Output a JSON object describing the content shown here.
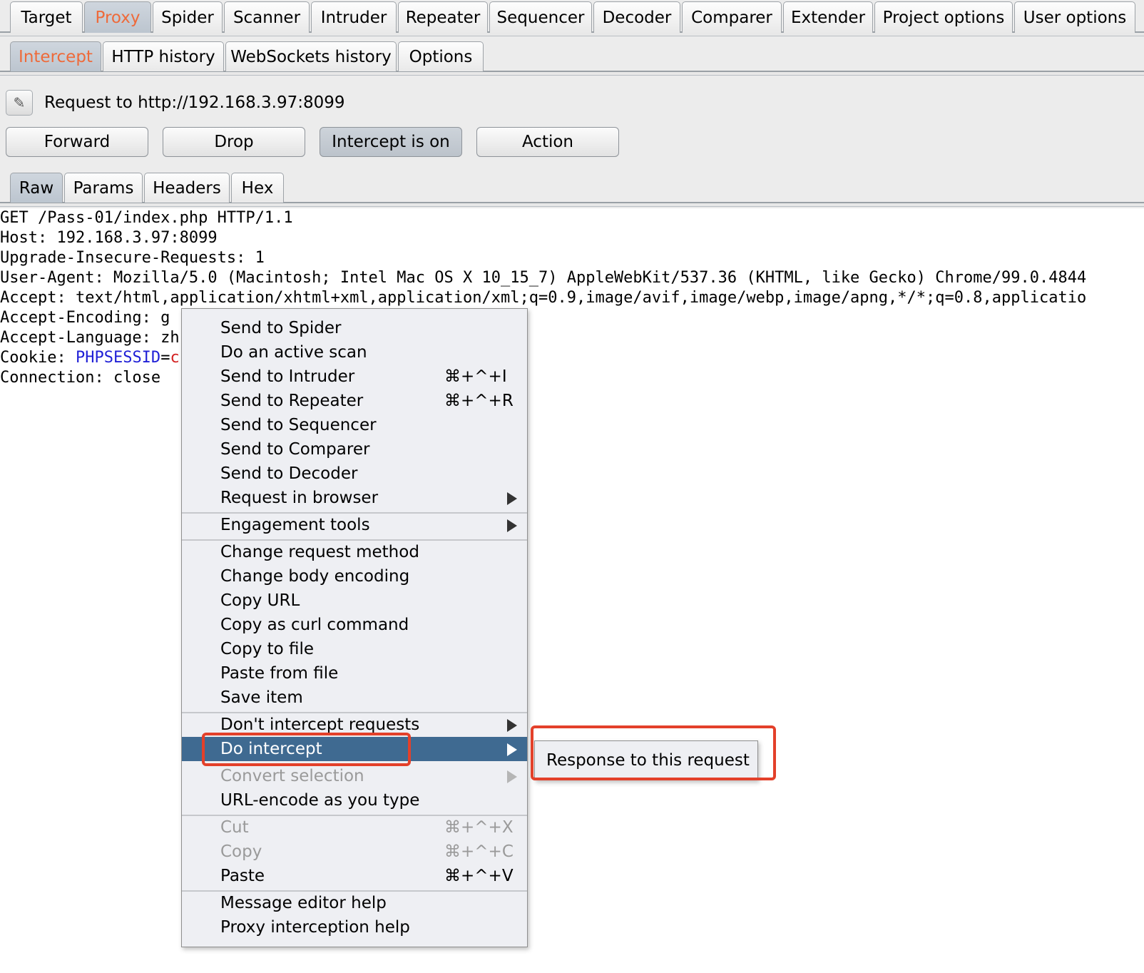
{
  "main_tabs": [
    "Target",
    "Proxy",
    "Spider",
    "Scanner",
    "Intruder",
    "Repeater",
    "Sequencer",
    "Decoder",
    "Comparer",
    "Extender",
    "Project options",
    "User options"
  ],
  "sub_tabs": [
    "Intercept",
    "HTTP history",
    "WebSockets history",
    "Options"
  ],
  "intercept": {
    "request_label": "Request to http://192.168.3.97:8099",
    "buttons": {
      "forward": "Forward",
      "drop": "Drop",
      "intercept": "Intercept is on",
      "action": "Action"
    }
  },
  "editor_tabs": [
    "Raw",
    "Params",
    "Headers",
    "Hex"
  ],
  "raw_lines": {
    "l0": "GET /Pass-01/index.php HTTP/1.1",
    "l1": "Host: 192.168.3.97:8099",
    "l2": "Upgrade-Insecure-Requests: 1",
    "l3": "User-Agent: Mozilla/5.0 (Macintosh; Intel Mac OS X 10_15_7) AppleWebKit/537.36 (KHTML, like Gecko) Chrome/99.0.4844",
    "l4": "Accept: text/html,application/xhtml+xml,application/xml;q=0.9,image/avif,image/webp,image/apng,*/*;q=0.8,applicatio",
    "l5": "Accept-Encoding: g",
    "l6": "Accept-Language: zh",
    "l7_key": "Cookie: ",
    "l7_name": "PHPSESSID",
    "l7_eq": "=",
    "l7_val": "c",
    "l8": "Connection: close"
  },
  "context_menu": {
    "items": [
      {
        "label": "Send to Spider"
      },
      {
        "label": "Do an active scan"
      },
      {
        "label": "Send to Intruder",
        "shortcut": "⌘+^+I"
      },
      {
        "label": "Send to Repeater",
        "shortcut": "⌘+^+R"
      },
      {
        "label": "Send to Sequencer"
      },
      {
        "label": "Send to Comparer"
      },
      {
        "label": "Send to Decoder"
      },
      {
        "label": "Request in browser"
      },
      {
        "label": "Engagement tools"
      },
      {
        "label": "Change request method"
      },
      {
        "label": "Change body encoding"
      },
      {
        "label": "Copy URL"
      },
      {
        "label": "Copy as curl command"
      },
      {
        "label": "Copy to file"
      },
      {
        "label": "Paste from file"
      },
      {
        "label": "Save item"
      },
      {
        "label": "Don't intercept requests"
      },
      {
        "label": "Do intercept"
      },
      {
        "label": "Convert selection"
      },
      {
        "label": "URL-encode as you type"
      },
      {
        "label": "Cut",
        "shortcut": "⌘+^+X"
      },
      {
        "label": "Copy",
        "shortcut": "⌘+^+C"
      },
      {
        "label": "Paste",
        "shortcut": "⌘+^+V"
      },
      {
        "label": "Message editor help"
      },
      {
        "label": "Proxy interception help"
      }
    ]
  },
  "submenu": {
    "label": "Response to this request"
  },
  "colors": {
    "accent": "#ee6a3a",
    "menu_highlight": "#3f6a91",
    "annotation": "#e3402a"
  }
}
